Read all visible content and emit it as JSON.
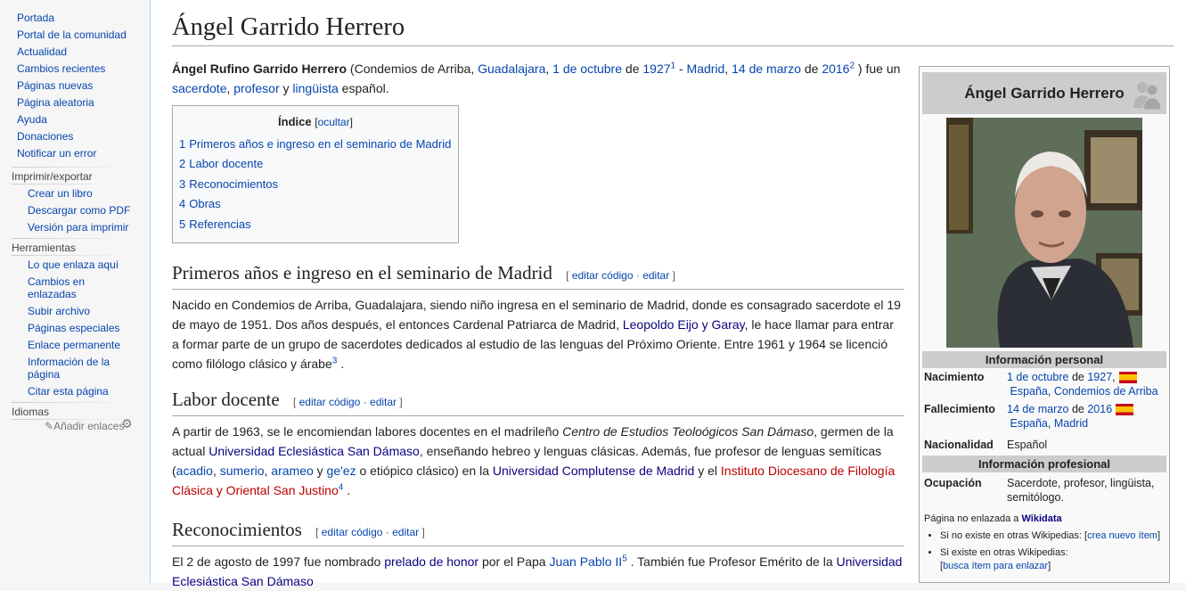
{
  "sidebar": {
    "nav": [
      "Portada",
      "Portal de la comunidad",
      "Actualidad",
      "Cambios recientes",
      "Páginas nuevas",
      "Página aleatoria",
      "Ayuda",
      "Donaciones",
      "Notificar un error"
    ],
    "print": {
      "title": "Imprimir/exportar",
      "items": [
        "Crear un libro",
        "Descargar como PDF",
        "Versión para imprimir"
      ]
    },
    "tools": {
      "title": "Herramientas",
      "items": [
        "Lo que enlaza aquí",
        "Cambios en enlazadas",
        "Subir archivo",
        "Páginas especiales",
        "Enlace permanente",
        "Información de la página",
        "Citar esta página"
      ]
    },
    "lang": {
      "title": "Idiomas",
      "add": "Añadir enlaces"
    }
  },
  "article": {
    "title": "Ángel Garrido Herrero",
    "intro": {
      "bold": "Ángel Rufino Garrido Herrero",
      "t1": " (Condemios de Arriba",
      "l1": "Guadalajara",
      "l2": "1 de octubre",
      "t2": " de ",
      "l3": "1927",
      "s1": "1",
      "t3": " - ",
      "l4": "Madrid",
      "l5": "14 de marzo",
      "t4": " de ",
      "l6": "2016",
      "s2": "2",
      "t5": " ) fue un ",
      "l7": "sacerdote",
      "l8": "profesor",
      "t6": " y ",
      "l9": "lingüista",
      "t7": " español."
    },
    "toc": {
      "title": "Índice",
      "toggle": "ocultar",
      "items": [
        {
          "num": "1",
          "label": "Primeros años e ingreso en el seminario de Madrid"
        },
        {
          "num": "2",
          "label": "Labor docente"
        },
        {
          "num": "3",
          "label": "Reconocimientos"
        },
        {
          "num": "4",
          "label": "Obras"
        },
        {
          "num": "5",
          "label": "Referencias"
        }
      ]
    },
    "edit": {
      "code": "editar código",
      "edit": "editar"
    },
    "s1": {
      "heading": "Primeros años e ingreso en el seminario de Madrid",
      "t1": "Nacido en Condemios de Arriba, Guadalajara, siendo niño ingresa en el seminario de Madrid, donde es consagrado sacerdote el 19 de mayo de 1951. Dos años después, el entonces Cardenal Patriarca de Madrid, ",
      "l1": "Leopoldo Eijo y Garay",
      "t2": ", le hace llamar para entrar a formar parte de un grupo de sacerdotes dedicados al estudio de las lenguas del Próximo Oriente. Entre 1961 y 1964 se licenció como filólogo clásico y árabe",
      "sup": "3",
      "t3": " ."
    },
    "s2": {
      "heading": "Labor docente",
      "t1": "A partir de 1963, se le encomiendan labores docentes en el madrileño ",
      "em": "Centro de Estudios Teoloógicos San Dámaso",
      "t2": ", germen de la actual ",
      "l1": "Universidad Eclesiástica San Dámaso",
      "t3": ", enseñando hebreo y lenguas clásicas. Además, fue profesor de lenguas semíticas (",
      "l2": "acadio",
      "l3": "sumerio",
      "l4": "arameo",
      "t4": " y ",
      "l5": "ge'ez",
      "t5": " o etiópico clásico) en la ",
      "l6": "Universidad Complutense de Madrid",
      "t6": " y el ",
      "l7": "Instituto Diocesano de Filología Clásica y Oriental San Justino",
      "sup": "4",
      "t7": " ."
    },
    "s3": {
      "heading": "Reconocimientos",
      "t1": "El 2 de agosto de 1997 fue nombrado ",
      "l1": "prelado de honor",
      "t2": " por el Papa ",
      "l2": "Juan Pablo II",
      "sup": "5",
      "t3": " . También fue Profesor Emérito de la ",
      "l3": "Universidad Eclesiástica San Dámaso"
    }
  },
  "infobox": {
    "title": "Ángel Garrido Herrero",
    "personal": "Información personal",
    "birth": {
      "label": "Nacimiento",
      "l1": "1 de octubre",
      "t1": " de ",
      "l2": "1927",
      "t2": ",",
      "l3": "España",
      "l4": "Condemios de Arriba"
    },
    "death": {
      "label": "Fallecimiento",
      "l1": "14 de marzo",
      "t1": " de ",
      "l2": "2016",
      "l3": "España",
      "l4": "Madrid"
    },
    "nation": {
      "label": "Nacionalidad",
      "value": "Español"
    },
    "professional": "Información profesional",
    "job": {
      "label": "Ocupación",
      "value": "Sacerdote, profesor, lingüista, semitólogo."
    },
    "wikidata": {
      "t1": "Página no enlazada a ",
      "l1": "Wikidata",
      "b1": "Si no existe en otras Wikipedias: ",
      "b1l": "crea nuevo ítem",
      "b2": "Si existe en otras Wikipedias:",
      "b2l": "busca ítem para enlazar"
    }
  },
  "colors": {
    "link": "#0645ad",
    "redlink": "#ba0000",
    "visited": "#0b0080",
    "border": "#a2a9b1",
    "header": "#cccccc"
  }
}
